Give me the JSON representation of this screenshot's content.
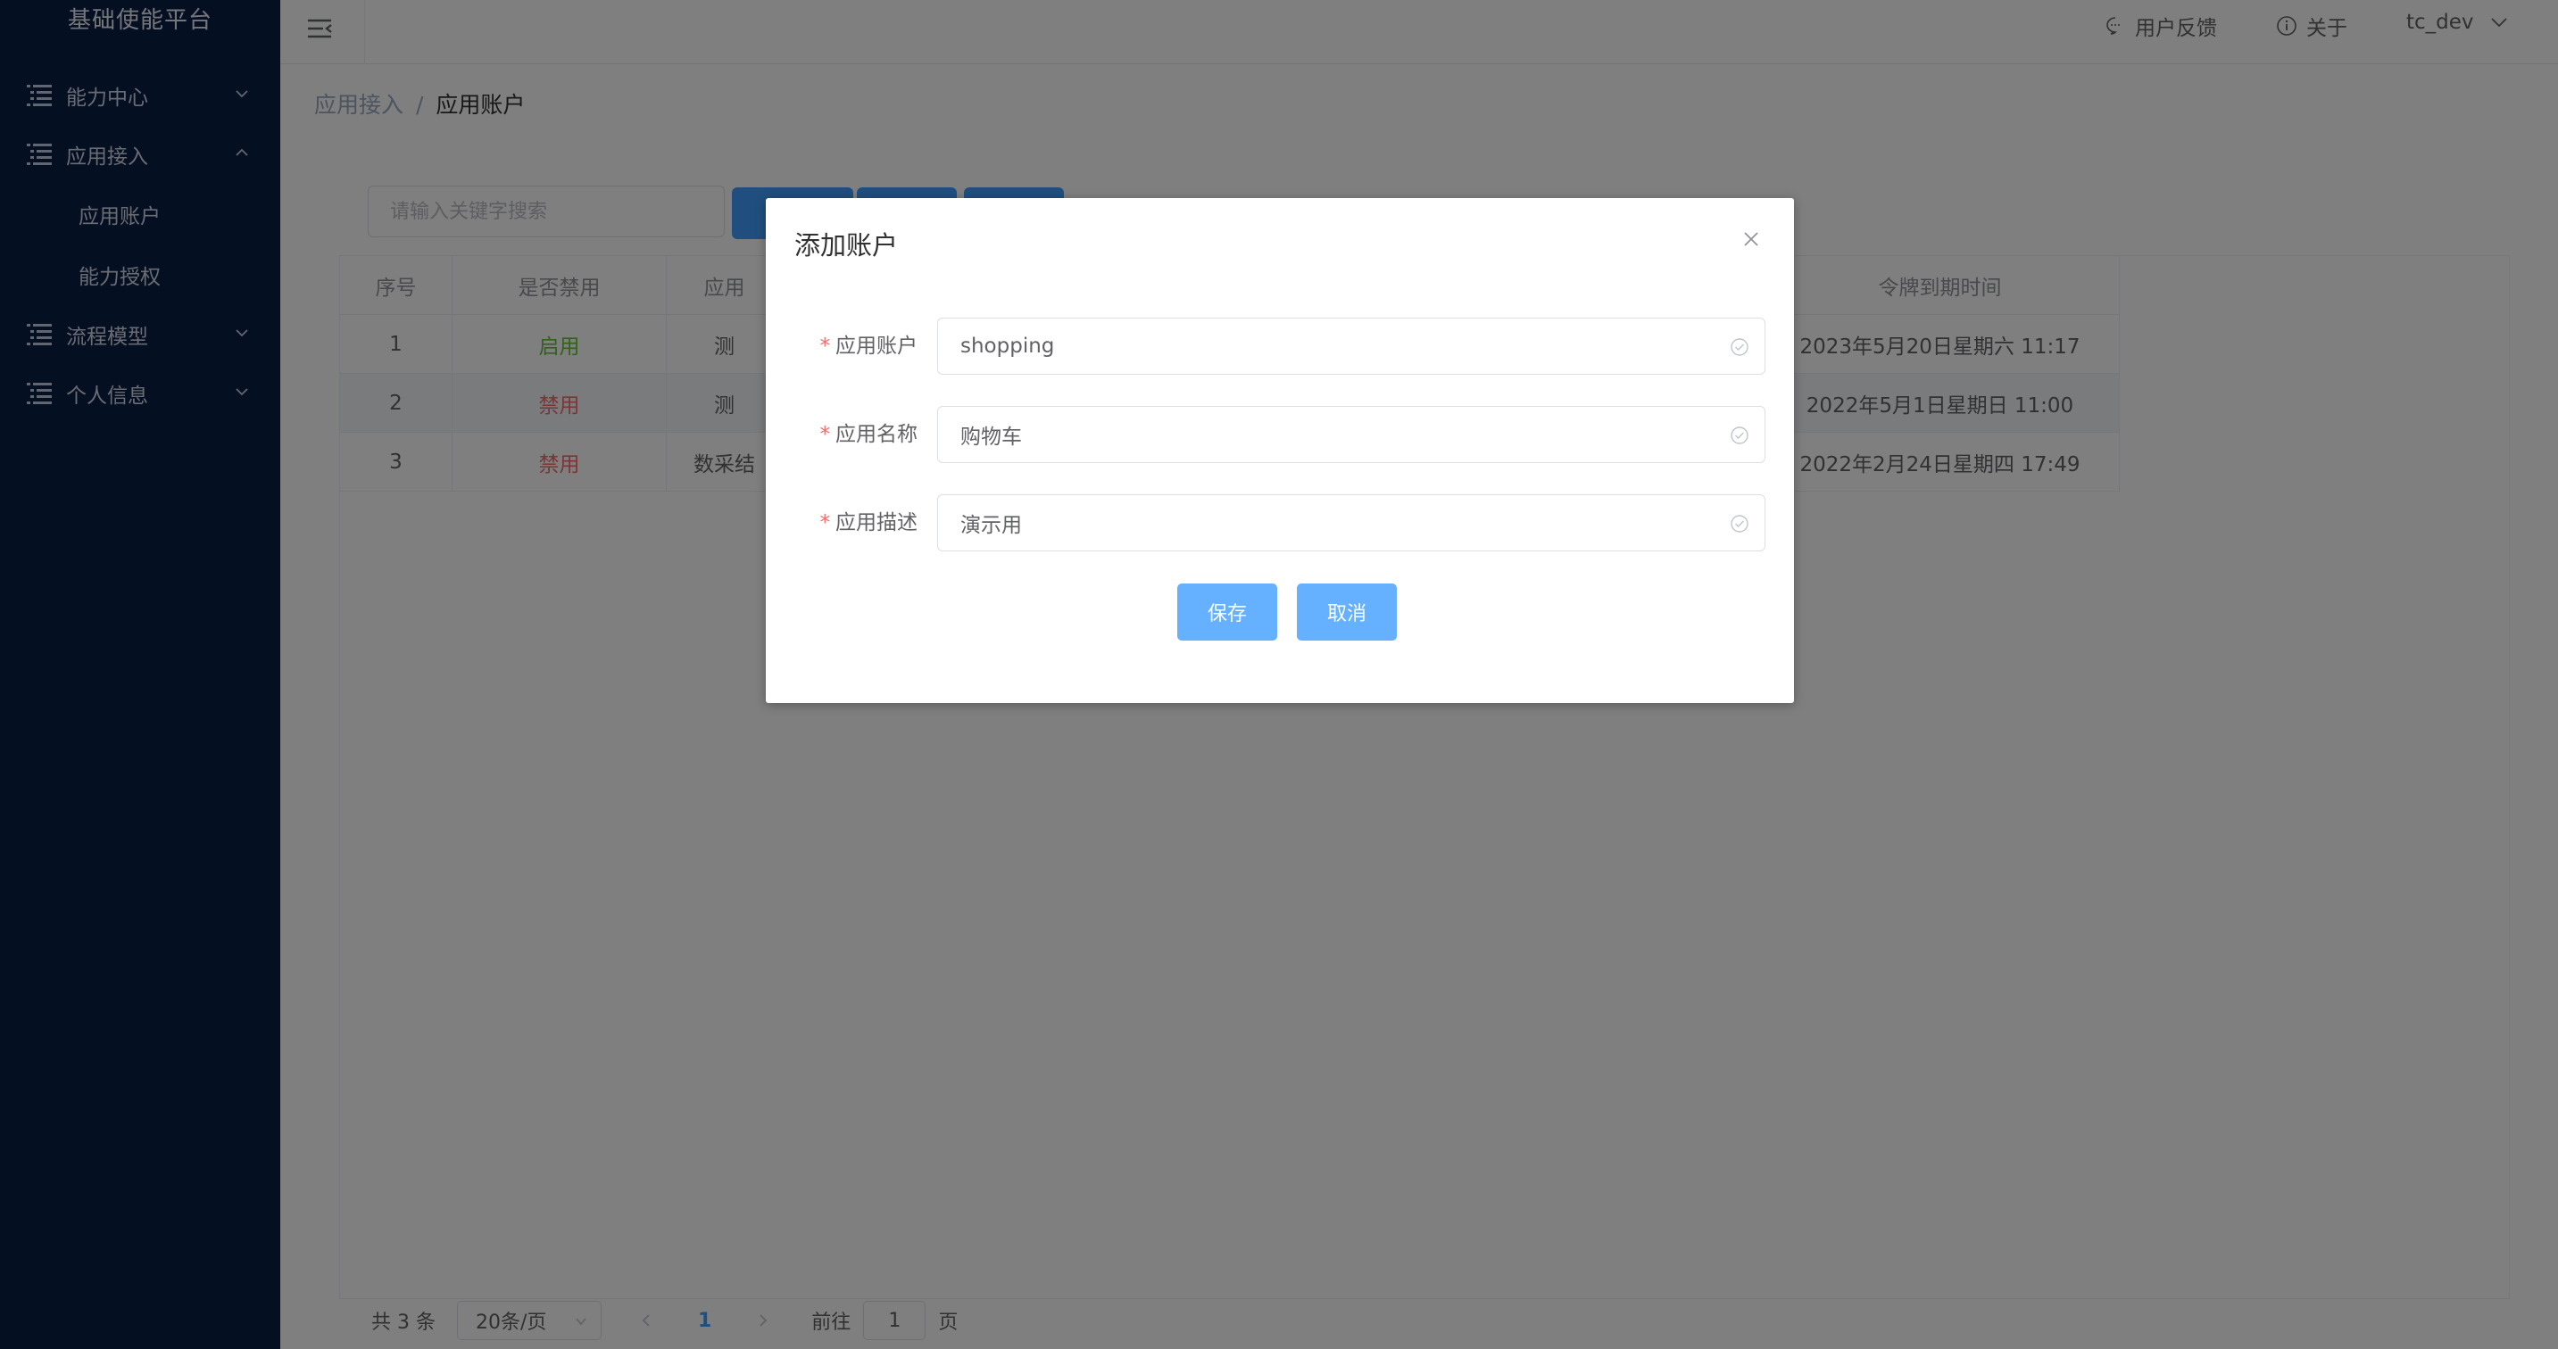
{
  "sidebar": {
    "brand": "基础使能平台",
    "menu": [
      {
        "label": "能力中心"
      },
      {
        "label": "应用接入"
      },
      {
        "label": "流程模型"
      },
      {
        "label": "个人信息"
      }
    ],
    "submenu": [
      {
        "label": "应用账户"
      },
      {
        "label": "能力授权"
      }
    ]
  },
  "header": {
    "feedback": "用户反馈",
    "about": "关于",
    "user": "tc_dev"
  },
  "breadcrumb": {
    "parent": "应用接入",
    "separator": "/",
    "current": "应用账户"
  },
  "toolbar": {
    "search_placeholder": "请输入关键字搜索"
  },
  "table": {
    "headers": [
      "序号",
      "是否禁用",
      "应用",
      "令牌到期时间"
    ],
    "rows": [
      {
        "index": "1",
        "status": "启用",
        "app": "测",
        "token_expiry": "2023年5月20日星期六 11:17"
      },
      {
        "index": "2",
        "status": "禁用",
        "app": "测",
        "token_expiry": "2022年5月1日星期日 11:00"
      },
      {
        "index": "3",
        "status": "禁用",
        "app": "数采结",
        "token_expiry": "2022年2月24日星期四 17:49"
      }
    ]
  },
  "pagination": {
    "total": "共 3 条",
    "page_size": "20条/页",
    "current_page": "1",
    "goto_prefix": "前往",
    "goto_value": "1",
    "goto_suffix": "页"
  },
  "dialog": {
    "title": "添加账户",
    "required_mark": "*",
    "fields": [
      {
        "label": "应用账户",
        "value": "shopping"
      },
      {
        "label": "应用名称",
        "value": "购物车"
      },
      {
        "label": "应用描述",
        "value": "演示用"
      }
    ],
    "save_label": "保存",
    "cancel_label": "取消"
  },
  "colors": {
    "sidebar_bg": "#0b1e45",
    "primary": "#409eff",
    "enabled": "#67c23a",
    "disabled": "#f56c6c"
  }
}
